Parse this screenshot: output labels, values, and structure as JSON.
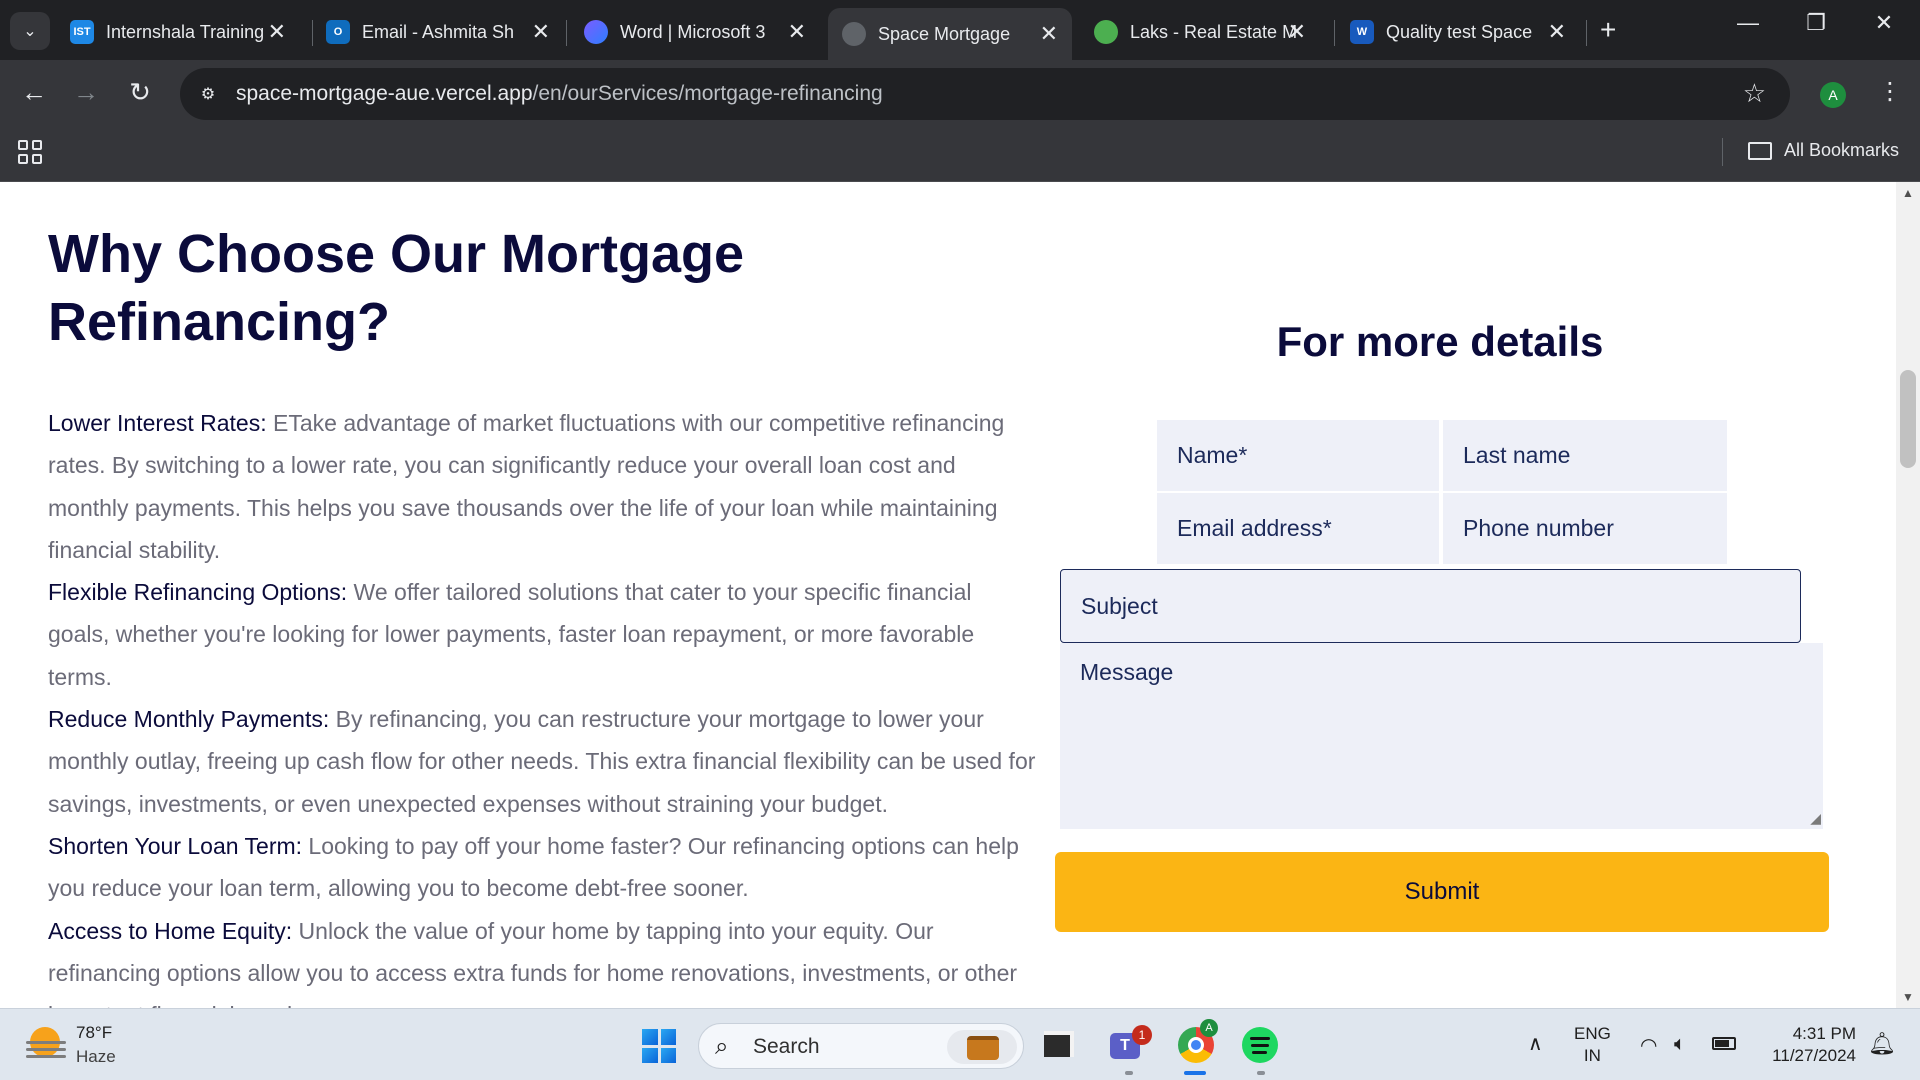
{
  "browser": {
    "tabs": [
      {
        "title": "Internshala Training",
        "favicon_text": "IST",
        "favicon_color": "#1e88e5",
        "active": false
      },
      {
        "title": "Email - Ashmita Sh",
        "favicon_text": "O",
        "favicon_color": "#0f6cbd",
        "active": false
      },
      {
        "title": "Word | Microsoft 3",
        "favicon_text": "",
        "favicon_color": "#5b3fd6",
        "active": false
      },
      {
        "title": "Space Mortgage",
        "favicon_text": "",
        "favicon_color": "#5f6368",
        "active": true
      },
      {
        "title": "Laks - Real Estate M",
        "favicon_text": "",
        "favicon_color": "#4caf50",
        "active": false
      },
      {
        "title": "Quality test Space",
        "favicon_text": "W",
        "favicon_color": "#185abd",
        "active": false
      }
    ],
    "url_host": "space-mortgage-aue.vercel.app",
    "url_path": "/en/ourServices/mortgage-refinancing",
    "profile_initial": "A",
    "all_bookmarks_label": "All Bookmarks"
  },
  "page": {
    "heading_line1": "Why Choose Our Mortgage",
    "heading_line2": "Refinancing?",
    "benefits": [
      {
        "label": "Lower Interest Rates:",
        "text": " ETake advantage of market fluctuations with our competitive refinancing rates. By switching to a lower rate, you can significantly reduce your overall loan cost and monthly payments. This helps you save thousands over the life of your loan while maintaining financial stability."
      },
      {
        "label": "Flexible Refinancing Options:",
        "text": " We offer tailored solutions that cater to your specific financial goals, whether you're looking for lower payments, faster loan repayment, or more favorable terms."
      },
      {
        "label": "Reduce Monthly Payments:",
        "text": " By refinancing, you can restructure your mortgage to lower your monthly outlay, freeing up cash flow for other needs. This extra financial flexibility can be used for savings, investments, or even unexpected expenses without straining your budget."
      },
      {
        "label": "Shorten Your Loan Term:",
        "text": " Looking to pay off your home faster? Our refinancing options can help you reduce your loan term, allowing you to become debt-free sooner."
      },
      {
        "label": "Access to Home Equity:",
        "text": " Unlock the value of your home by tapping into your equity. Our refinancing options allow you to access extra funds for home renovations, investments, or other important financial needs."
      }
    ],
    "form": {
      "title": "For more details",
      "name_placeholder": "Name*",
      "lastname_placeholder": "Last name",
      "email_placeholder": "Email address*",
      "phone_placeholder": "Phone number",
      "subject_placeholder": "Subject",
      "message_placeholder": "Message",
      "submit_label": "Submit",
      "submit_color": "#fbb514"
    }
  },
  "taskbar": {
    "weather_temp": "78°F",
    "weather_desc": "Haze",
    "search_label": "Search",
    "teams_badge": "1",
    "lang_line1": "ENG",
    "lang_line2": "IN",
    "time": "4:31 PM",
    "date": "11/27/2024"
  }
}
